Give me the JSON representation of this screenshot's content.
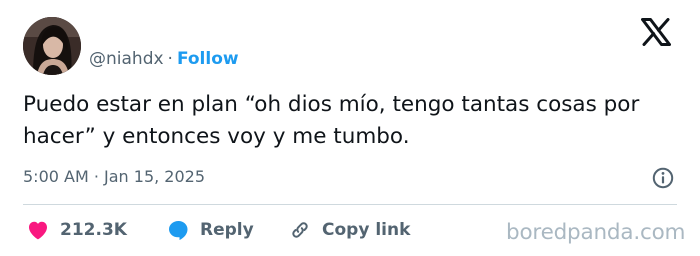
{
  "header": {
    "handle": "@niahdx",
    "separator": "·",
    "follow_label": "Follow"
  },
  "tweet": {
    "text": "Puedo estar en plan “oh dios mío, tengo tantas cosas por hacer” y entonces voy y me tumbo.",
    "timestamp": "5:00 AM · Jan 15, 2025"
  },
  "actions": {
    "likes": "212.3K",
    "reply_label": "Reply",
    "copy_link_label": "Copy link"
  },
  "watermark": "boredpanda.com",
  "icons": [
    "avatar",
    "x-logo-icon",
    "info-icon",
    "heart-icon",
    "reply-bubble-icon",
    "link-icon"
  ],
  "colors": {
    "follow": "#1d9bf0",
    "like": "#f91880",
    "reply": "#1d9bf0",
    "secondary_text": "#536471"
  }
}
